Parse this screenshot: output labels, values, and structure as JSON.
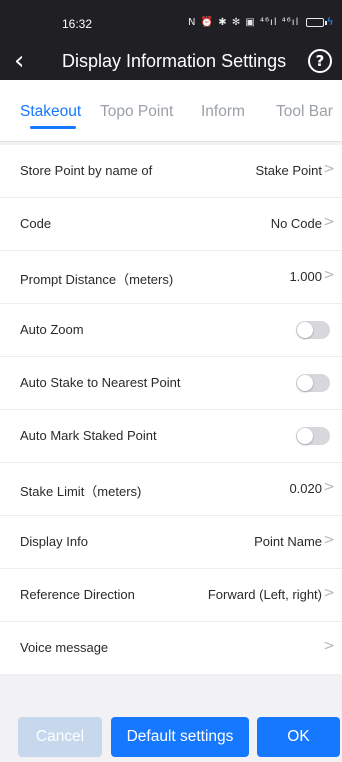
{
  "status_bar": {
    "time": "16:32",
    "icons": "N ⏰ ✱ ✻ ▣ ⁴⁶ıl ⁴⁶ıl",
    "battery_state": "charging"
  },
  "header": {
    "back_icon": "chevron-left-icon",
    "title": "Display Information Settings",
    "help_icon": "question-circle-icon",
    "help_glyph": "?"
  },
  "tabs": [
    {
      "label": "Stakeout",
      "active": true
    },
    {
      "label": "Topo Point",
      "active": false
    },
    {
      "label": "Inform",
      "active": false
    },
    {
      "label": "Tool Bar",
      "active": false
    }
  ],
  "settings": [
    {
      "label": "Store Point by name of",
      "value": "Stake Point",
      "type": "select"
    },
    {
      "label": "Code",
      "value": "No Code",
      "type": "select"
    },
    {
      "label": "Prompt Distance（meters)",
      "value": "1.000",
      "type": "select"
    },
    {
      "label": "Auto Zoom",
      "type": "toggle",
      "on": false
    },
    {
      "label": "Auto Stake to Nearest Point",
      "type": "toggle",
      "on": false
    },
    {
      "label": "Auto Mark Staked Point",
      "type": "toggle",
      "on": false
    },
    {
      "label": "Stake Limit（meters)",
      "value": "0.020",
      "type": "select"
    },
    {
      "label": "Display Info",
      "value": "Point Name",
      "type": "select"
    },
    {
      "label": "Reference Direction",
      "value": "Forward (Left, right)",
      "type": "select"
    },
    {
      "label": "Voice message",
      "value": "",
      "type": "select"
    }
  ],
  "buttons": {
    "cancel": "Cancel",
    "default": "Default settings",
    "ok": "OK"
  },
  "colors": {
    "accent": "#1677ff",
    "header_bg": "#1f1f24",
    "disabled_button": "#c7d8ec",
    "toggle_off": "#d7d7dc"
  }
}
